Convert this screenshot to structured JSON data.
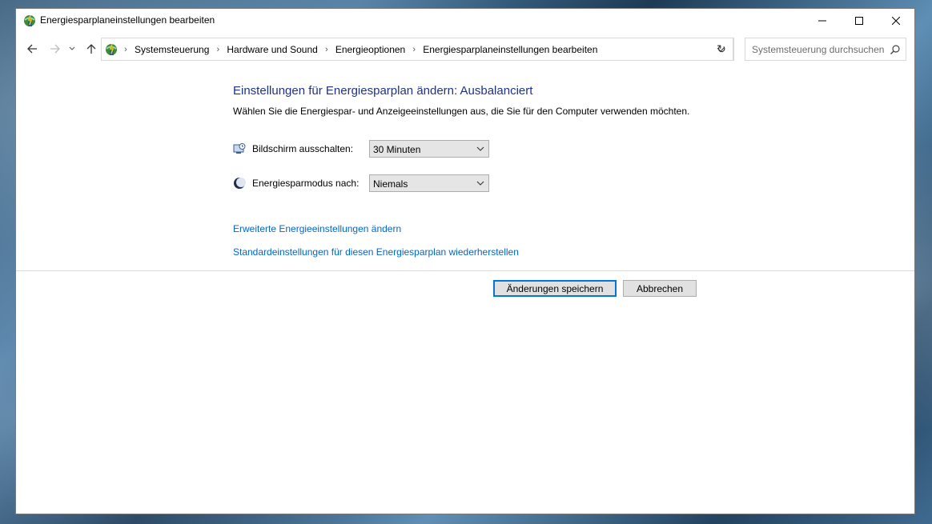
{
  "window": {
    "title": "Energiesparplaneinstellungen bearbeiten",
    "icons": {
      "app": "power-options-icon",
      "minimize": "minimize-icon",
      "maximize": "maximize-icon",
      "close": "close-icon"
    }
  },
  "navigation": {
    "breadcrumbs": [
      "Systemsteuerung",
      "Hardware und Sound",
      "Energieoptionen",
      "Energiesparplaneinstellungen bearbeiten"
    ],
    "search_placeholder": "Systemsteuerung durchsuchen",
    "refresh_glyph": "↻"
  },
  "main": {
    "title": "Einstellungen für Energiesparplan ändern: Ausbalanciert",
    "description": "Wählen Sie die Energiespar- und Anzeigeeinstellungen aus, die Sie für den Computer verwenden möchten.",
    "settings": [
      {
        "label": "Bildschirm ausschalten:",
        "value": "30 Minuten",
        "icon": "monitor-icon"
      },
      {
        "label": "Energiesparmodus nach:",
        "value": "Niemals",
        "icon": "sleep-moon-icon"
      }
    ],
    "links": {
      "advanced": "Erweiterte Energieeinstellungen ändern",
      "restore": "Standardeinstellungen für diesen Energiesparplan wiederherstellen"
    },
    "buttons": {
      "save": "Änderungen speichern",
      "cancel": "Abbrechen"
    }
  },
  "colors": {
    "title_blue": "#1e3287",
    "link_blue": "#0066cc",
    "focus_blue": "#0078d7"
  }
}
